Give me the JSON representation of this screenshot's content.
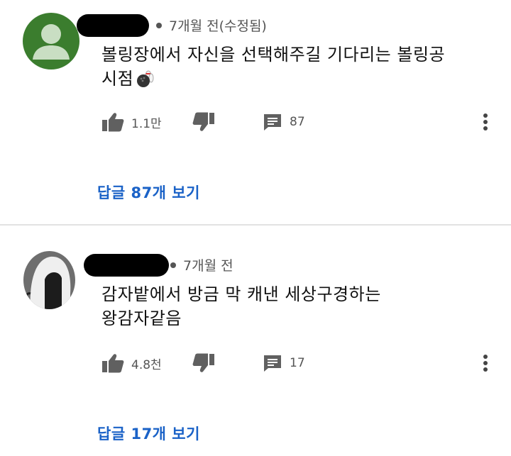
{
  "comments": [
    {
      "time": "7개월 전(수정됨)",
      "text_line1": "볼링장에서 자신을 선택해주길 기다리는 볼링공",
      "text_line2": "시점",
      "emoji": "bowling-emoji",
      "likes": "1.1만",
      "reply_count": "87",
      "replies_link": "답글 87개 보기"
    },
    {
      "time": "7개월 전",
      "text_line1": "감자밭에서 방금 막 캐낸 세상구경하는",
      "text_line2": "왕감자같음",
      "likes": "4.8천",
      "reply_count": "17",
      "replies_link": "답글 17개 보기"
    }
  ],
  "colors": {
    "link": "#1a62c7",
    "icon": "#606060",
    "avatar1": "#3b7d2e"
  }
}
